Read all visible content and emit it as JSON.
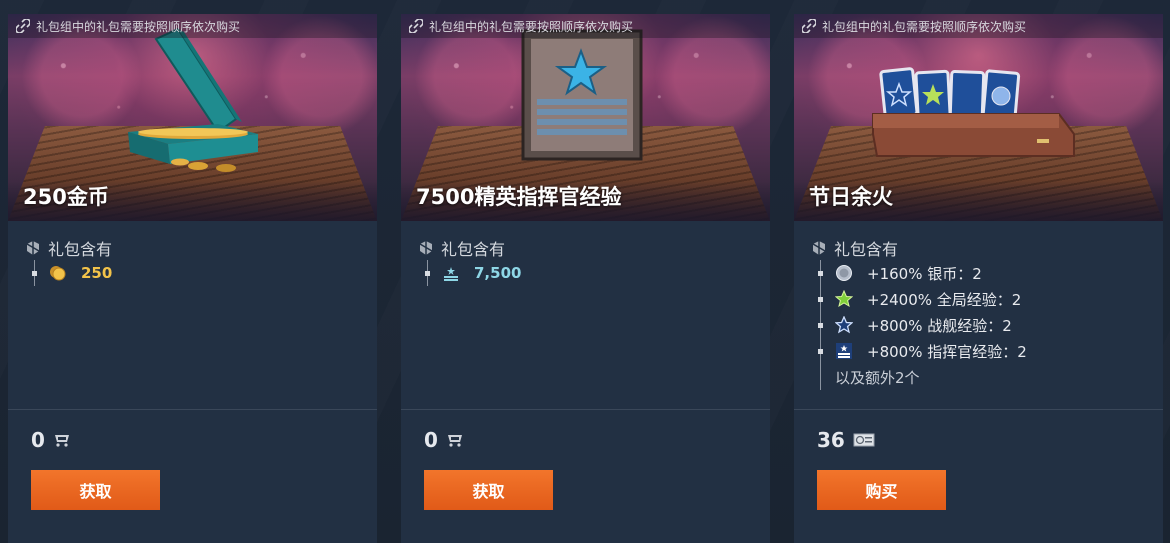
{
  "cards": [
    {
      "notice": "礼包组中的礼包需要按照顺序依次购买",
      "title": "250金币",
      "contents_label": "礼包含有",
      "items": [
        {
          "icon": "gold-coins-icon",
          "value": "250"
        }
      ],
      "price": "0",
      "price_currency_icon": "cart-icon",
      "button_label": "获取"
    },
    {
      "notice": "礼包组中的礼包需要按照顺序依次购买",
      "title": "7500精英指挥官经验",
      "contents_label": "礼包含有",
      "items": [
        {
          "icon": "commander-xp-icon",
          "value": "7,500"
        }
      ],
      "price": "0",
      "price_currency_icon": "cart-icon",
      "button_label": "获取"
    },
    {
      "notice": "礼包组中的礼包需要按照顺序依次购买",
      "title": "节日余火",
      "contents_label": "礼包含有",
      "items": [
        {
          "icon": "credits-icon",
          "text": "+160% 银币：2"
        },
        {
          "icon": "global-xp-star-icon",
          "text": "+2400% 全局经验：2"
        },
        {
          "icon": "ship-xp-star-icon",
          "text": "+800% 战舰经验：2"
        },
        {
          "icon": "commander-xp-icon",
          "text": "+800% 指挥官经验：2"
        }
      ],
      "more": "以及额外2个",
      "price": "36",
      "price_currency_icon": "doubloon-card-icon",
      "button_label": "购买"
    }
  ],
  "colors": {
    "background": "#1b2533",
    "card": "#223043",
    "button": "#e8661f",
    "gold": "#f3c34a",
    "xp": "#8ed6e6"
  }
}
